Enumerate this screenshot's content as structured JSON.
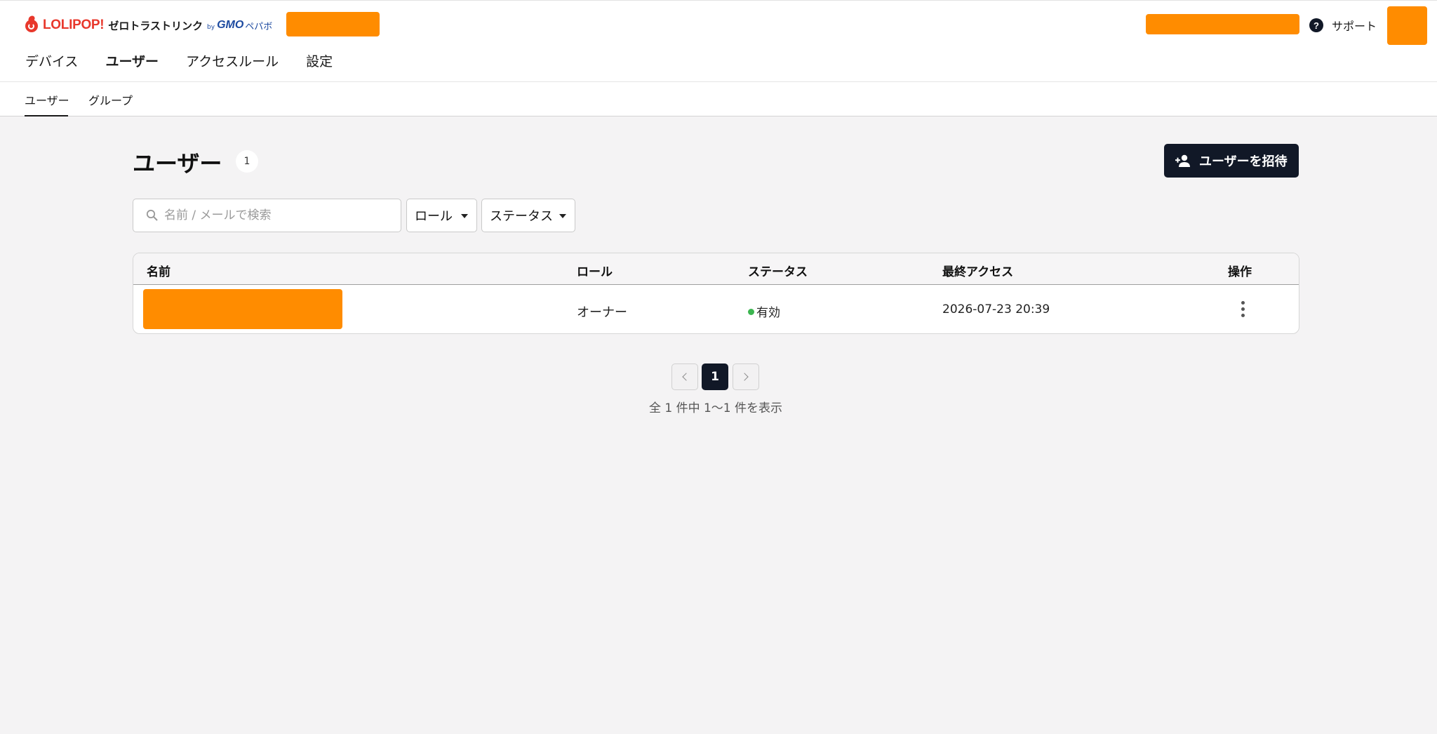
{
  "brand": {
    "lolipop": "LOLIPOP!",
    "product": "ゼロトラストリンク",
    "by": "by",
    "gmo": "GMO",
    "pepabo": "ペパボ"
  },
  "header": {
    "support_label": "サポート",
    "help_icon": "question-circle-icon"
  },
  "main_nav": {
    "items": [
      {
        "label": "デバイス"
      },
      {
        "label": "ユーザー",
        "active": true
      },
      {
        "label": "アクセスルール"
      },
      {
        "label": "設定"
      }
    ]
  },
  "sub_nav": {
    "items": [
      {
        "label": "ユーザー",
        "active": true
      },
      {
        "label": "グループ"
      }
    ]
  },
  "page": {
    "title": "ユーザー",
    "count": "1",
    "invite_button_label": "ユーザーを招待",
    "invite_icon": "person-add-icon"
  },
  "filters": {
    "search_placeholder": "名前 / メールで検索",
    "search_value": "",
    "role_label": "ロール",
    "status_label": "ステータス"
  },
  "table": {
    "columns": [
      "名前",
      "ロール",
      "ステータス",
      "最終アクセス",
      "操作"
    ],
    "rows": [
      {
        "name": "",
        "role": "オーナー",
        "status": "有効",
        "last_access": "2026-07-23 20:39"
      }
    ]
  },
  "pagination": {
    "current_page": "1",
    "summary": "全 1 件中 1〜1 件を表示"
  },
  "colors": {
    "accent_dark": "#111827",
    "brand_red": "#e8382c",
    "status_active": "#3cb550",
    "redaction": "#ff8c00"
  }
}
